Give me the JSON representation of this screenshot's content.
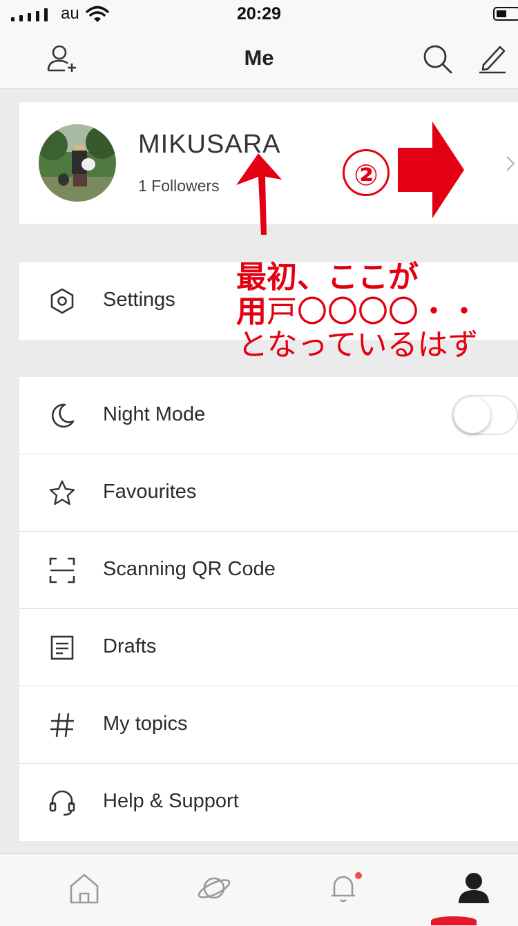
{
  "status_bar": {
    "carrier": "au",
    "time": "20:29"
  },
  "header": {
    "title": "Me",
    "add_friend_icon": "person-add-icon",
    "search_icon": "search-icon",
    "edit_icon": "pencil-icon"
  },
  "profile": {
    "username": "MIKUSARA",
    "followers": "1 Followers"
  },
  "menu": {
    "settings": "Settings",
    "night_mode": "Night Mode",
    "night_mode_on": false,
    "favourites": "Favourites",
    "scan": "Scanning QR Code",
    "drafts": "Drafts",
    "topics": "My topics",
    "help": "Help & Support"
  },
  "tabbar": {
    "items": [
      "home-icon",
      "planet-icon",
      "bell-icon",
      "profile-icon"
    ],
    "active": "profile-icon",
    "notification_dot": true
  },
  "annotations": {
    "step": "②",
    "line1": "最初、ここが",
    "line2_bold": "用",
    "line2_rest": "戸〇〇〇〇・・",
    "line3": "となっているはず",
    "color": "#e30012"
  }
}
